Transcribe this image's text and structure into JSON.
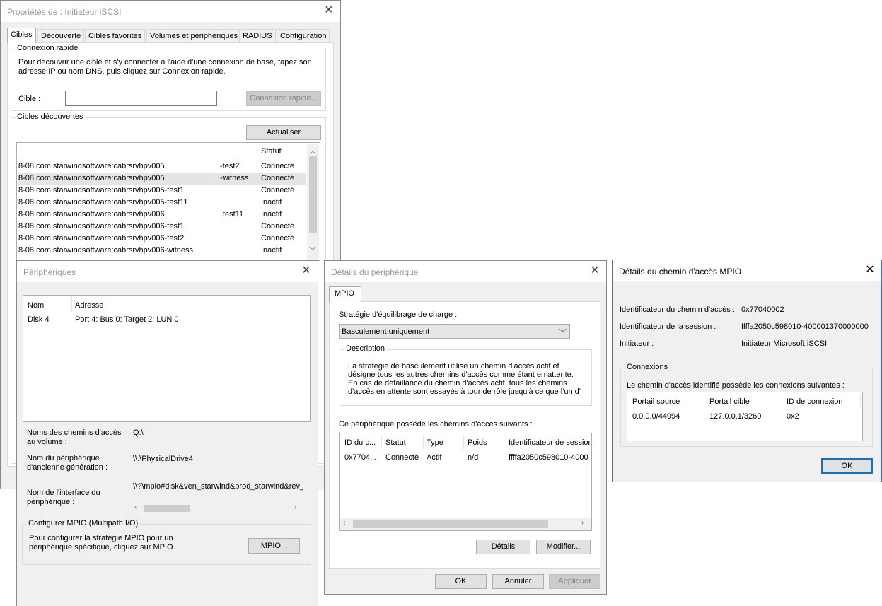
{
  "iscsi": {
    "title": "Propriétés de : Initiateur iSCSI",
    "tabs": [
      "Cibles",
      "Découverte",
      "Cibles favorites",
      "Volumes et périphériques",
      "RADIUS",
      "Configuration"
    ],
    "quick_group": "Connexion rapide",
    "quick_desc_1": "Pour découvrir une cible et s'y connecter à l'aide d'une connexion de base, tapez son",
    "quick_desc_2": "adresse IP ou nom DNS, puis cliquez sur Connexion rapide.",
    "target_label": "Cible :",
    "target_value": "",
    "quick_button": "Connexion rapide...",
    "discovered_group": "Cibles découvertes",
    "refresh_button": "Actualiser",
    "col_status": "Statut",
    "rows": [
      {
        "name": "8-08.com.starwindsoftware:cabrsrvhpv005.",
        "suffix": "-test2",
        "status": "Connecté"
      },
      {
        "name": "8-08.com.starwindsoftware:cabrsrvhpv005.",
        "suffix": "-witness",
        "status": "Connecté"
      },
      {
        "name": "8-08.com.starwindsoftware:cabrsrvhpv005-test1",
        "suffix": "",
        "status": "Connecté"
      },
      {
        "name": "8-08.com.starwindsoftware:cabrsrvhpv005-test11",
        "suffix": "",
        "status": "Inactif"
      },
      {
        "name": "8-08.com.starwindsoftware:cabrsrvhpv006.",
        "suffix": "test11",
        "status": "Inactif"
      },
      {
        "name": "8-08.com.starwindsoftware:cabrsrvhpv006-test1",
        "suffix": "",
        "status": "Connecté"
      },
      {
        "name": "8-08.com.starwindsoftware:cabrsrvhpv006-test2",
        "suffix": "",
        "status": "Connecté"
      },
      {
        "name": "8-08.com.starwindsoftware:cabrsrvhpv006-witness",
        "suffix": "",
        "status": "Inactif"
      }
    ]
  },
  "devices": {
    "title": "Périphériques",
    "col_name": "Nom",
    "col_address": "Adresse",
    "row_name": "Disk 4",
    "row_address": "Port 4: Bus 0: Target 2: LUN 0",
    "volume_label_1": "Noms des chemins d'accès",
    "volume_label_2": "au volume :",
    "volume_value": "Q:\\",
    "legacy_label_1": "Nom du périphérique",
    "legacy_label_2": "d'ancienne génération :",
    "legacy_value": "\\\\.\\PhysicalDrive4",
    "iface_label_1": "Nom de l'interface du",
    "iface_label_2": "périphérique :",
    "iface_value": "\\\\?\\mpio#disk&ven_starwind&prod_starwind&rev_",
    "mpio_group": "Configurer MPIO (Multipath I/O)",
    "mpio_desc_1": "Pour configurer la stratégie MPIO pour un",
    "mpio_desc_2": "périphérique spécifique, cliquez sur MPIO.",
    "mpio_button": "MPIO..."
  },
  "device_details": {
    "title": "Détails du périphérique",
    "tab": "MPIO",
    "policy_label": "Stratégie d'équilibrage de charge :",
    "policy_value": "Basculement uniquement",
    "description_group": "Description",
    "description_lines": [
      "La stratégie de basculement utilise un chemin d'accès actif et",
      "désigne tous les autres chemins d'accès comme étant en attente.",
      "En cas de défaillance du chemin d'accès actif, tous les chemins",
      "d'accès en attente sont essayés à tour de rôle jusqu'à ce que l'un d'"
    ],
    "paths_label": "Ce périphérique possède les chemins d'accès suivants :",
    "columns": [
      "ID du c...",
      "Statut",
      "Type",
      "Poids",
      "Identificateur de session"
    ],
    "row": [
      "0x7704...",
      "Connecté",
      "Actif",
      "n/d",
      "ffffa2050c598010-4000"
    ],
    "details_button": "Détails",
    "edit_button": "Modifier...",
    "ok_button": "OK",
    "cancel_button": "Annuler",
    "apply_button": "Appliquer"
  },
  "mpio_path": {
    "title": "Détails du chemin d'accès MPIO",
    "path_id_label": "Identificateur du chemin d'accès :",
    "path_id_value": "0x77040002",
    "session_label": "Identificateur de la session :",
    "session_value": "ffffa2050c598010-400001370000000",
    "initiator_label": "Initiateur :",
    "initiator_value": "Initiateur Microsoft iSCSI",
    "connections_group": "Connexions",
    "connections_desc": "Le chemin d'accès identifié possède les connexions suivantes :",
    "columns": [
      "Portail source",
      "Portail cible",
      "ID de connexion"
    ],
    "row": [
      "0.0.0.0/44994",
      "127.0.0.1/3260",
      "0x2"
    ],
    "ok_button": "OK"
  },
  "colors": {
    "accent": "#0078d7",
    "window_bg": "#f0f0f0",
    "selected_row": "#e5e5e5"
  }
}
